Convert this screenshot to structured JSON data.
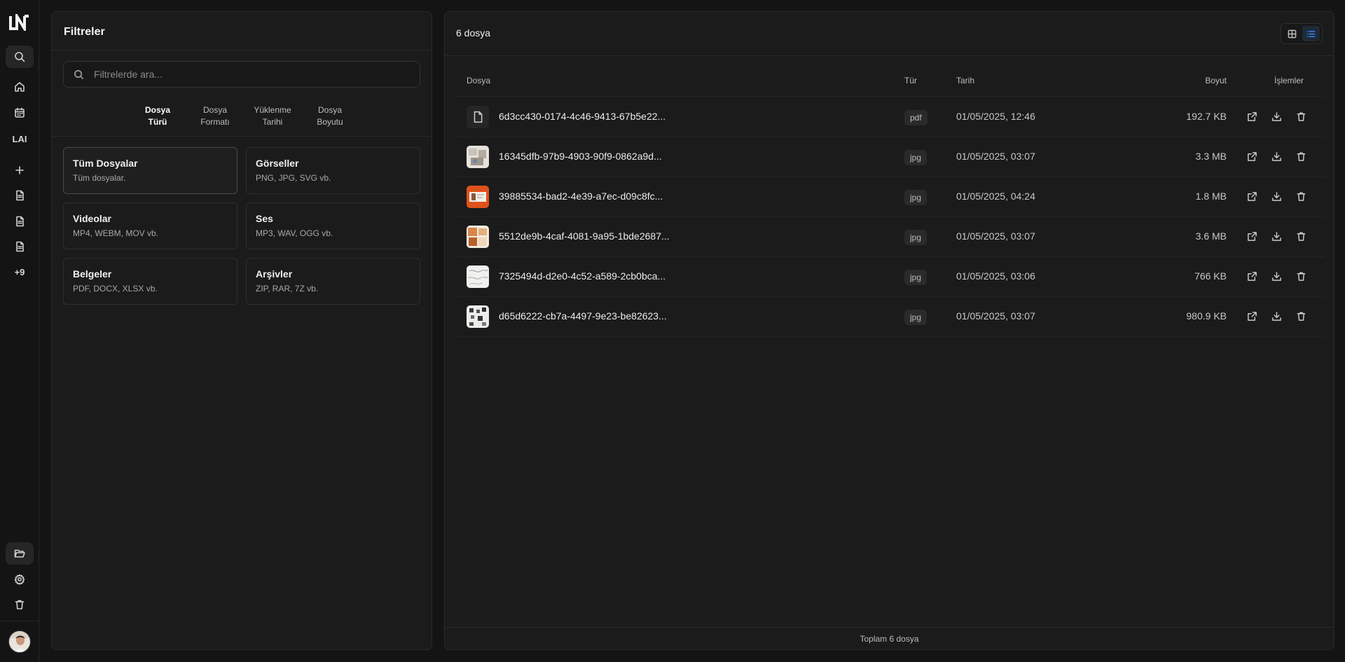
{
  "rail": {
    "logo": "LN",
    "items": [
      {
        "icon": "search-icon",
        "active": true
      },
      {
        "icon": "home-icon"
      },
      {
        "icon": "calendar-icon"
      },
      {
        "icon": "ai-icon",
        "label": "LAI"
      },
      {
        "icon": "plus-icon"
      },
      {
        "icon": "document-icon"
      },
      {
        "icon": "document-icon"
      },
      {
        "icon": "document-icon"
      }
    ],
    "more_label": "+9",
    "bottom": [
      {
        "icon": "folder-open-icon",
        "active": true
      },
      {
        "icon": "gear-icon"
      },
      {
        "icon": "trash-icon"
      }
    ]
  },
  "filters": {
    "title": "Filtreler",
    "search_placeholder": "Filtrelerde ara...",
    "tabs": [
      {
        "line1": "Dosya",
        "line2": "Türü",
        "active": true
      },
      {
        "line1": "Dosya",
        "line2": "Formatı"
      },
      {
        "line1": "Yüklenme",
        "line2": "Tarihi"
      },
      {
        "line1": "Dosya",
        "line2": "Boyutu"
      }
    ],
    "categories": [
      {
        "title": "Tüm Dosyalar",
        "desc": "Tüm dosyalar.",
        "active": true
      },
      {
        "title": "Görseller",
        "desc": "PNG, JPG, SVG vb."
      },
      {
        "title": "Videolar",
        "desc": "MP4, WEBM, MOV vb."
      },
      {
        "title": "Ses",
        "desc": "MP3, WAV, OGG vb."
      },
      {
        "title": "Belgeler",
        "desc": "PDF, DOCX, XLSX vb."
      },
      {
        "title": "Arşivler",
        "desc": "ZIP, RAR, 7Z vb."
      }
    ]
  },
  "files": {
    "count_label": "6 dosya",
    "view_modes": [
      "grid-icon",
      "list-icon"
    ],
    "active_view": "list",
    "accent_color": "#3b82f6",
    "columns": {
      "file": "Dosya",
      "type": "Tür",
      "date": "Tarih",
      "size": "Boyut",
      "actions": "İşlemler"
    },
    "rows": [
      {
        "name": "6d3cc430-0174-4c46-9413-67b5e22...",
        "type": "pdf",
        "date": "01/05/2025, 12:46",
        "size": "192.7 KB",
        "thumb": "file-icon"
      },
      {
        "name": "16345dfb-97b9-4903-90f9-0862a9d...",
        "type": "jpg",
        "date": "01/05/2025, 03:07",
        "size": "3.3 MB",
        "thumb": "image-thumbnail"
      },
      {
        "name": "39885534-bad2-4e39-a7ec-d09c8fc...",
        "type": "jpg",
        "date": "01/05/2025, 04:24",
        "size": "1.8 MB",
        "thumb": "image-thumbnail"
      },
      {
        "name": "5512de9b-4caf-4081-9a95-1bde2687...",
        "type": "jpg",
        "date": "01/05/2025, 03:07",
        "size": "3.6 MB",
        "thumb": "image-thumbnail"
      },
      {
        "name": "7325494d-d2e0-4c52-a589-2cb0bca...",
        "type": "jpg",
        "date": "01/05/2025, 03:06",
        "size": "766 KB",
        "thumb": "image-thumbnail"
      },
      {
        "name": "d65d6222-cb7a-4497-9e23-be82623...",
        "type": "jpg",
        "date": "01/05/2025, 03:07",
        "size": "980.9 KB",
        "thumb": "image-thumbnail"
      }
    ],
    "row_actions": [
      "external-link-icon",
      "download-icon",
      "trash-icon"
    ],
    "footer": "Toplam 6 dosya"
  }
}
